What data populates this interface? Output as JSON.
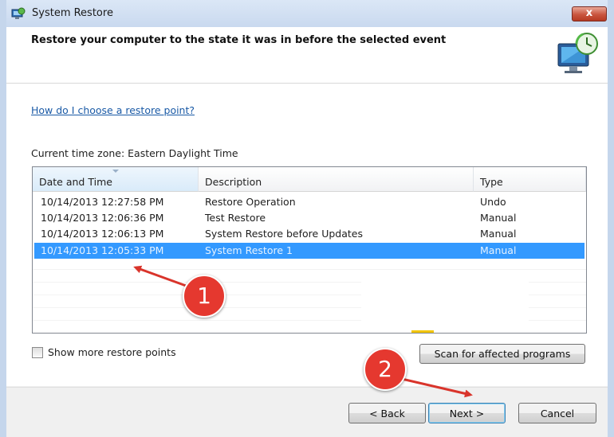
{
  "window": {
    "title": "System Restore",
    "close_label": "x"
  },
  "header": {
    "title": "Restore your computer to the state it was in before the selected event",
    "logo_icon": "system-restore-icon"
  },
  "help_link": "How do I choose a restore point?",
  "timezone_label": "Current time zone: Eastern Daylight Time",
  "list": {
    "columns": [
      "Date and Time",
      "Description",
      "Type"
    ],
    "sorted_column": "Date and Time",
    "rows": [
      {
        "datetime": "10/14/2013 12:27:58 PM",
        "description": "Restore Operation",
        "type": "Undo",
        "selected": false
      },
      {
        "datetime": "10/14/2013 12:06:36 PM",
        "description": "Test Restore",
        "type": "Manual",
        "selected": false
      },
      {
        "datetime": "10/14/2013 12:06:13 PM",
        "description": "System Restore before Updates",
        "type": "Manual",
        "selected": false
      },
      {
        "datetime": "10/14/2013 12:05:33 PM",
        "description": "System Restore 1",
        "type": "Manual",
        "selected": true
      }
    ],
    "selection_color": "#3399ff"
  },
  "show_more_checkbox": {
    "label": "Show more restore points",
    "checked": false
  },
  "scan_button": "Scan for affected programs",
  "footer": {
    "back_label": "< Back",
    "next_label": "Next >",
    "cancel_label": "Cancel"
  },
  "annotations": {
    "badge_1": "1",
    "badge_2": "2",
    "badge_color": "#e5382f"
  }
}
